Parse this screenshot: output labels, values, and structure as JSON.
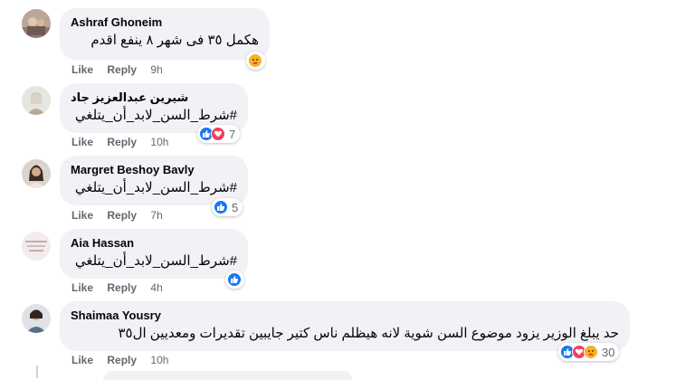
{
  "ui": {
    "like_label": "Like",
    "reply_label": "Reply",
    "accent_like": "#1877f2",
    "accent_love": "#f33e58",
    "accent_care": "#f7b125"
  },
  "comments": [
    {
      "author": "Ashraf Ghoneim",
      "text": "هكمل ٣٥ فى شهر ٨ ينفع اقدم",
      "time": "9h",
      "reactions": [
        "care-reaction-icon"
      ],
      "reaction_count": ""
    },
    {
      "author": "شيرين عبدالعزيز جاد",
      "text": "#شرط_السن_لابد_أن_يتلغي",
      "time": "10h",
      "reactions": [
        "like-reaction-icon",
        "love-reaction-icon"
      ],
      "reaction_count": "7"
    },
    {
      "author": "Margret Beshoy Bavly",
      "text": "#شرط_السن_لابد_أن_يتلغي",
      "time": "7h",
      "reactions": [
        "like-reaction-icon"
      ],
      "reaction_count": "5"
    },
    {
      "author": "Aia Hassan",
      "text": "#شرط_السن_لابد_أن_يتلغي",
      "time": "4h",
      "reactions": [
        "like-reaction-icon"
      ],
      "reaction_count": ""
    },
    {
      "author": "Shaimaa Yousry",
      "text": "حد يبلغ الوزير يزود موضوع السن شوية لانه هيظلم ناس كتير جايبين تقديرات ومعديين ال٣٥",
      "time": "10h",
      "reactions": [
        "like-reaction-icon",
        "love-reaction-icon",
        "care-reaction-icon"
      ],
      "reaction_count": "30"
    }
  ]
}
